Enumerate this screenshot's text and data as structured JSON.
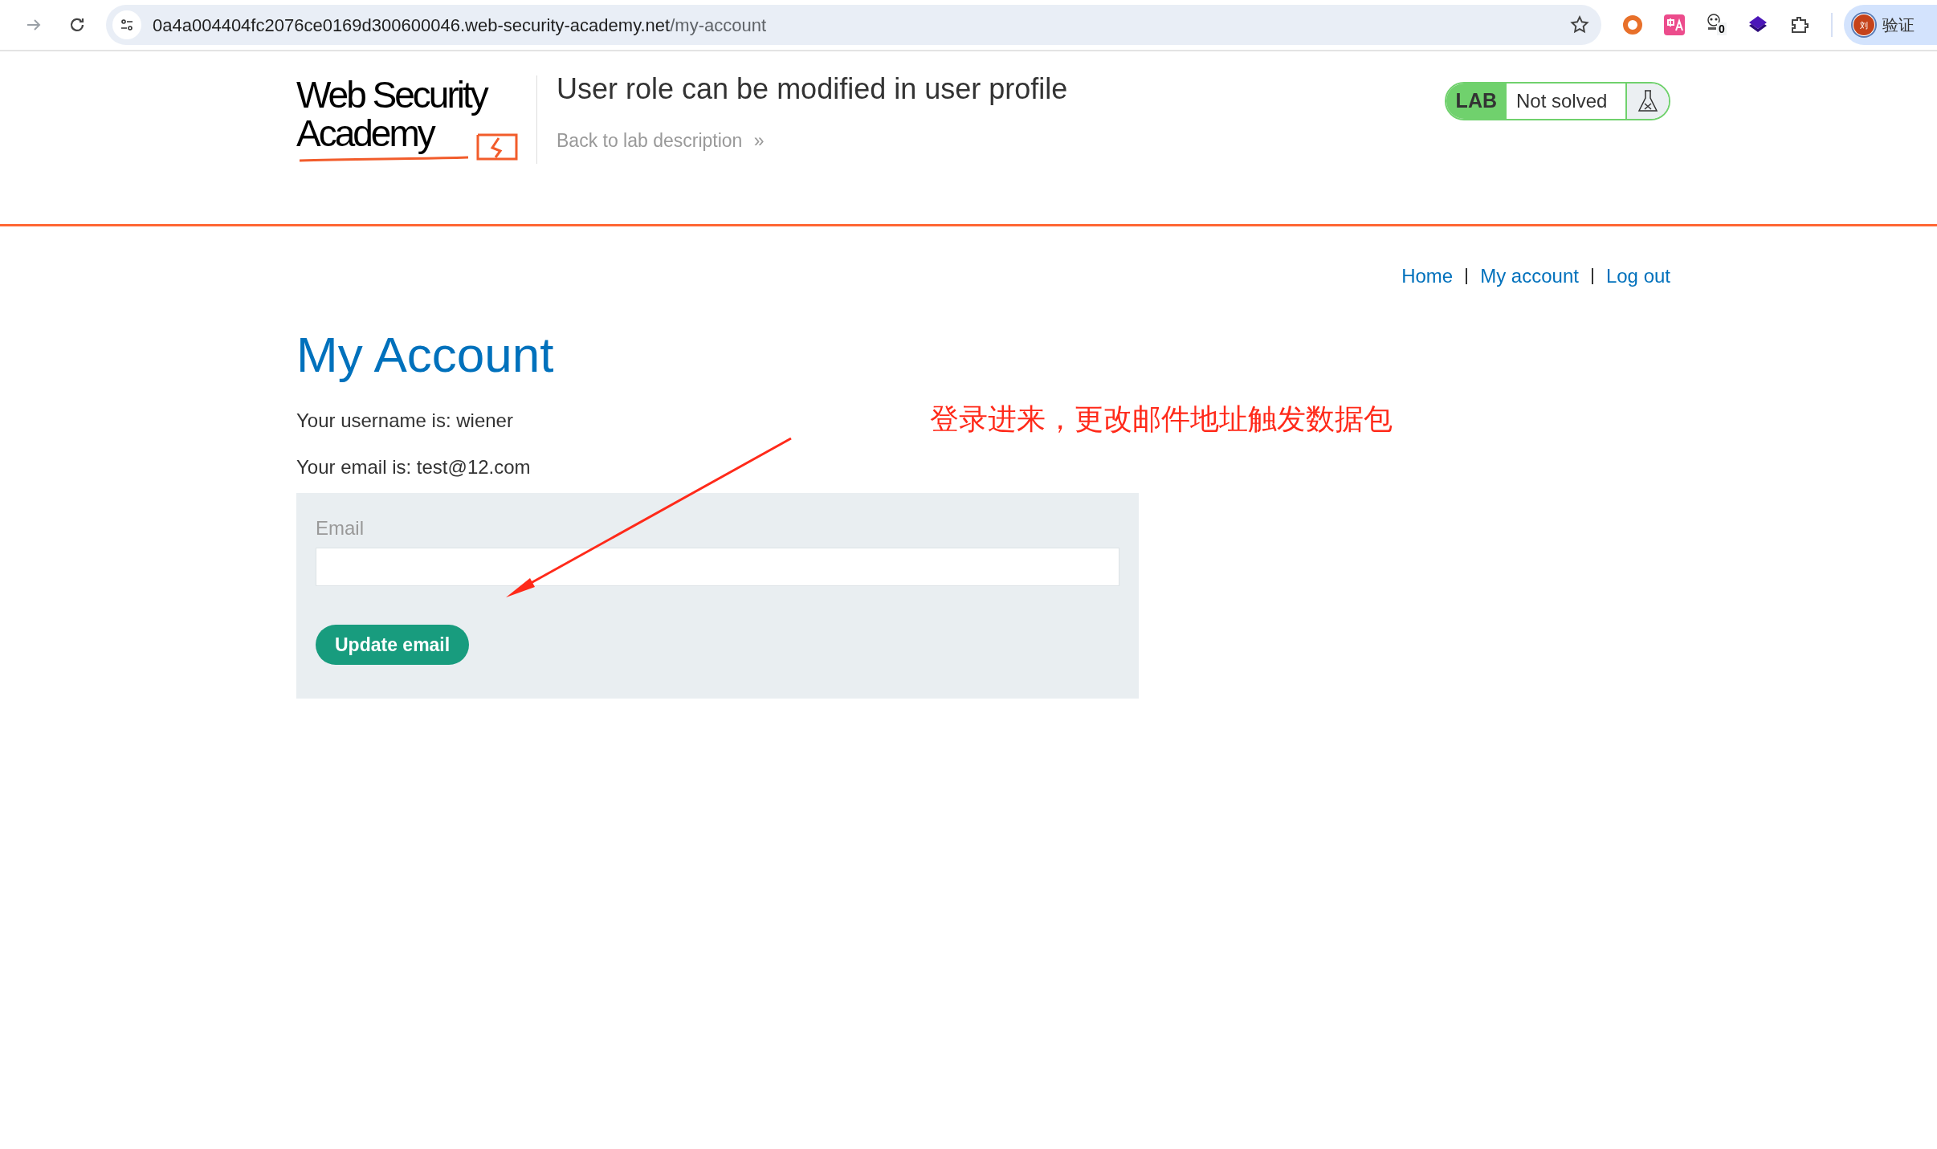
{
  "browser": {
    "url_host": "0a4a004404fc2076ce0169d300600046.web-security-academy.net",
    "url_path": "/my-account",
    "extension_badge": "0",
    "profile_initial": "刘",
    "profile_label": "验证"
  },
  "header": {
    "logo_top": "Web Security",
    "logo_bottom": "Academy",
    "lab_title": "User role can be modified in user profile",
    "back_link": "Back to lab description",
    "back_chevrons": "»",
    "lab_tag": "LAB",
    "status": "Not solved",
    "solved": false
  },
  "nav": [
    "Home",
    "My account",
    "Log out"
  ],
  "page": {
    "heading": "My Account",
    "lines": [
      "Your username is: wiener",
      "Your email is: test@12.com"
    ],
    "form": {
      "label": "Email",
      "button": "Update email"
    }
  },
  "annotation": {
    "text": "登录进来，更改邮件地址触发数据包"
  }
}
